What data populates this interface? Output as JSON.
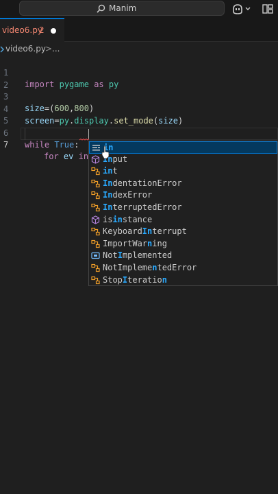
{
  "titlebar": {
    "search_label": "Manim"
  },
  "tab": {
    "filename": "video6.py",
    "problem_count": "2"
  },
  "breadcrumb": {
    "file": "video6.py",
    "separator": ">",
    "more": "..."
  },
  "editor": {
    "lines": [
      {
        "number": "1"
      },
      {
        "number": "2"
      },
      {
        "number": "3"
      },
      {
        "number": "4"
      },
      {
        "number": "5"
      },
      {
        "number": "6"
      },
      {
        "number": "7"
      }
    ],
    "line1": {
      "kw": "import",
      "mod": "pygame",
      "as": "as",
      "alias": "py"
    },
    "line3": {
      "var": "size",
      "eq": "=(",
      "n1": "600",
      "comma": ",",
      "n2": "800",
      "close": ")"
    },
    "line4": {
      "var": "screen",
      "eq": "=",
      "obj": "py",
      "dot1": ".",
      "attr": "display",
      "dot2": ".",
      "fn": "set_mode",
      "open": "(",
      "arg": "size",
      "close": ")"
    },
    "line6": {
      "kw": "while",
      "val": "True",
      "colon": ":"
    },
    "line7": {
      "kw": "for",
      "var": "ev",
      "typed": "in"
    }
  },
  "suggestions": [
    {
      "pre": "",
      "match": "in",
      "post": "",
      "kind": "keyword",
      "selected": true
    },
    {
      "pre": "",
      "match": "In",
      "post": "put",
      "kind": "function"
    },
    {
      "pre": "",
      "match": "in",
      "post": "t",
      "kind": "class"
    },
    {
      "pre": "",
      "match": "In",
      "post": "dentationError",
      "kind": "class"
    },
    {
      "pre": "",
      "match": "In",
      "post": "dexError",
      "kind": "class"
    },
    {
      "pre": "",
      "match": "In",
      "post": "terruptedError",
      "kind": "class"
    },
    {
      "pre": "is",
      "match": "in",
      "post": "stance",
      "kind": "function"
    },
    {
      "pre": "Keyboard",
      "match": "In",
      "post": "terrupt",
      "kind": "class"
    },
    {
      "pre": "ImportWar",
      "match": "n",
      "post": "ing",
      "kind": "class"
    },
    {
      "pre": "Not",
      "match": "I",
      "post": "mplemented",
      "kind": "variable"
    },
    {
      "pre": "NotImpleme",
      "match": "n",
      "post": "tedError",
      "kind": "class"
    },
    {
      "pre": "Stop",
      "match": "I",
      "post": "teratio",
      "tail_match": "n",
      "kind": "class"
    }
  ],
  "icons": {
    "search": "search-icon",
    "copilot": "copilot-icon",
    "layout": "layout-icon",
    "keyword": "keyword-icon",
    "function": "method-cube-icon",
    "class": "class-icon",
    "variable": "variable-icon"
  },
  "colors": {
    "accent": "#0078d4",
    "error": "#f48771",
    "match": "#2aaaff"
  }
}
